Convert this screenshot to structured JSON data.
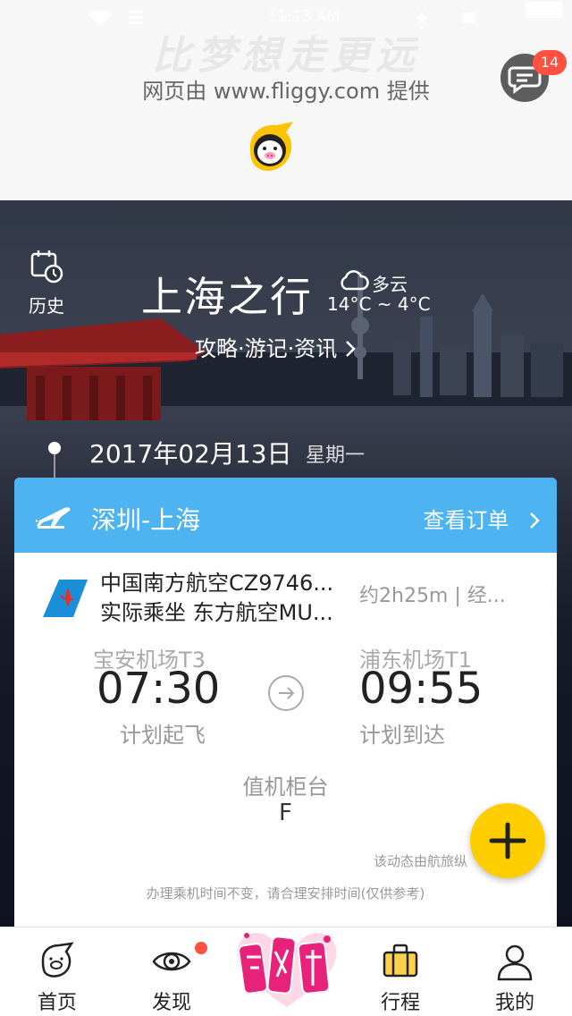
{
  "status_bar": {
    "time": "11:13 AM"
  },
  "browser": {
    "slogan": "比梦想走更远",
    "provider_text": "网页由 www.fliggy.com 提供",
    "message_badge": "14"
  },
  "hero": {
    "history_label": "历史",
    "trip_title": "上海之行",
    "weather_condition": "多云",
    "weather_temps": "14°C ~ 4°C",
    "guide_link": "攻略·游记·资讯",
    "date": "2017年02月13日",
    "weekday": "星期一"
  },
  "flight_card": {
    "route": "深圳-上海",
    "view_order": "查看订单",
    "flight_number": "中国南方航空CZ9746...",
    "actual_carrier": "实际乘坐 东方航空MU...",
    "duration": "约2h25m | 经...",
    "departure": {
      "airport": "宝安机场T3",
      "time": "07:30",
      "label": "计划起飞"
    },
    "arrival": {
      "airport": "浦东机场T1",
      "time": "09:55",
      "label": "计划到达"
    },
    "checkin_counter_title": "值机柜台",
    "checkin_counter_value": "F",
    "source_note": "该动态由航旅纵",
    "checkin_note": "办理乘机时间不变，请合理安排时间(仅供参考)"
  },
  "tabbar": {
    "home": "首页",
    "discover": "发现",
    "trips": "行程",
    "mine": "我的"
  },
  "colors": {
    "route_bar": "#4db3f1",
    "fab": "#ffce00",
    "badge": "#ff5040",
    "hero_bg": "#161a27"
  },
  "icons": {
    "history": "calendar-clock-icon",
    "weather": "cloud-icon",
    "route": "airplane-icon",
    "airline": "china-southern-logo-icon",
    "fab": "plus-icon",
    "message": "chat-bubble-icon",
    "home": "pig-icon",
    "discover": "eye-icon",
    "trips": "suitcase-icon",
    "mine": "person-icon"
  }
}
